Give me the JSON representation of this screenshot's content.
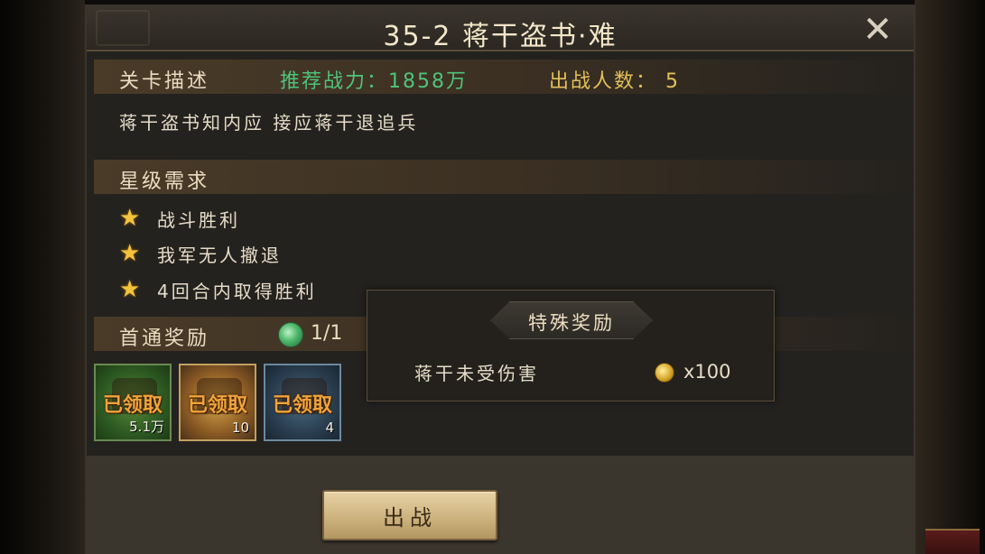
{
  "title": "35-2 蒋干盗书·难",
  "header": {
    "stage_desc_label": "关卡描述",
    "recommended_power": "推荐战力：1858万",
    "fighters_count": "出战人数： 5"
  },
  "description": "蒋干盗书知内应 接应蒋干退追兵",
  "star_section": {
    "label": "星级需求",
    "requirements": [
      "战斗胜利",
      "我军无人撤退",
      "4回合内取得胜利"
    ]
  },
  "first_clear": {
    "label": "首通奖励",
    "progress": "1/1",
    "rewards": [
      {
        "status": "已领取",
        "qty": "5.1万"
      },
      {
        "status": "已领取",
        "qty": "10"
      },
      {
        "status": "已领取",
        "qty": "4"
      }
    ]
  },
  "special_reward": {
    "title": "特殊奖励",
    "condition": "蒋干未受伤害",
    "amount": "x100"
  },
  "fight_button": "出战",
  "close_icon": "close-icon",
  "colors": {
    "recommended_power": "#4fc37a",
    "fighters": "#e2c05a",
    "star": "#f3c23b",
    "claimed": "#f0a43a"
  }
}
